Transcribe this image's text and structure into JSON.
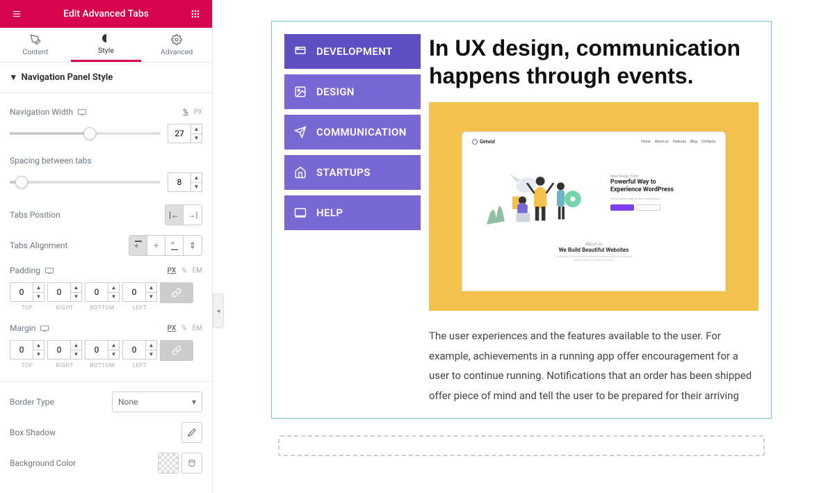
{
  "header": {
    "title": "Edit Advanced Tabs"
  },
  "panelTabs": {
    "content": "Content",
    "style": "Style",
    "advanced": "Advanced"
  },
  "section": {
    "title": "Navigation Panel Style"
  },
  "controls": {
    "navWidth": {
      "label": "Navigation Width",
      "value": "27",
      "sliderPercent": 53,
      "units": {
        "pct": "%",
        "px": "PX"
      }
    },
    "spacing": {
      "label": "Spacing between tabs",
      "value": "8",
      "sliderPercent": 8
    },
    "tabsPosition": {
      "label": "Tabs Position"
    },
    "tabsAlignment": {
      "label": "Tabs Alignment"
    },
    "padding": {
      "label": "Padding",
      "units": {
        "px": "PX",
        "pct": "%",
        "em": "EM"
      },
      "top": "0",
      "right": "0",
      "bottom": "0",
      "left": "0",
      "topL": "TOP",
      "rightL": "RIGHT",
      "bottomL": "BOTTOM",
      "leftL": "LEFT"
    },
    "margin": {
      "label": "Margin",
      "units": {
        "px": "PX",
        "pct": "%",
        "em": "EM"
      },
      "top": "0",
      "right": "0",
      "bottom": "0",
      "left": "0",
      "topL": "TOP",
      "rightL": "RIGHT",
      "bottomL": "BOTTOM",
      "leftL": "LEFT"
    },
    "borderType": {
      "label": "Border Type",
      "value": "None"
    },
    "boxShadow": {
      "label": "Box Shadow"
    },
    "bgColor": {
      "label": "Background Color"
    }
  },
  "preview": {
    "tabs": {
      "development": "DEVELOPMENT",
      "design": "DESIGN",
      "communication": "COMMUNICATION",
      "startups": "STARTUPS",
      "help": "HELP"
    },
    "heading": "In UX design, communication happens through events.",
    "body": "The user experiences and the features available to the user. For example, achievements in a running app offer encouragement for a user to continue running. Notifications that an order has been shipped offer piece of mind and tell the user to be prepared for their arriving",
    "mock": {
      "brand": "Getwid",
      "nav": [
        "Home",
        "About us",
        "Features",
        "Blog",
        "Contacts"
      ],
      "kicker": "Ideal Design Tools",
      "title1": "Powerful Way to",
      "title2": "Experience WordPress",
      "aboutH": "About Us",
      "aboutS": "We Build Beautiful Websites"
    }
  }
}
